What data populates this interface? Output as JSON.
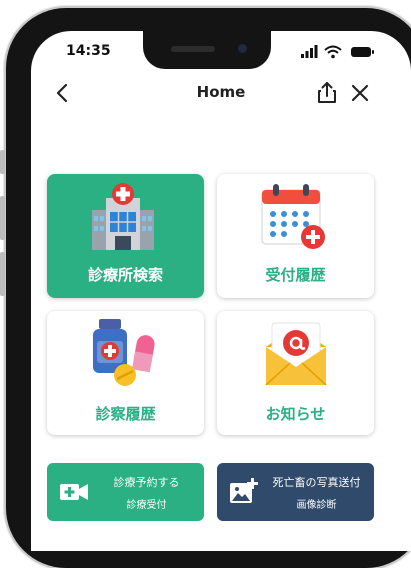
{
  "status": {
    "time": "14:35"
  },
  "nav": {
    "title": "Home",
    "back_icon": "chevron-left-icon",
    "share_icon": "share-icon",
    "close_icon": "close-icon"
  },
  "tiles": [
    {
      "label": "診療所検索",
      "icon": "hospital-icon",
      "bg": "#2bb084",
      "label_color": "#ffffff"
    },
    {
      "label": "受付履歴",
      "icon": "calendar-icon",
      "bg": "#ffffff",
      "label_color": "#2bb084"
    },
    {
      "label": "診察履歴",
      "icon": "medicine-icon",
      "bg": "#ffffff",
      "label_color": "#2bb084"
    },
    {
      "label": "お知らせ",
      "icon": "mail-icon",
      "bg": "#ffffff",
      "label_color": "#2bb084"
    }
  ],
  "buttons": [
    {
      "title": "診療予約する",
      "subtitle": "診療受付",
      "icon": "video-add-icon",
      "bg": "#2bb084"
    },
    {
      "title": "死亡畜の写真送付",
      "subtitle": "画像診断",
      "icon": "image-add-icon",
      "bg": "#2f4a6a"
    }
  ],
  "colors": {
    "accent": "#2bb084",
    "dark_button": "#2f4a6a"
  }
}
